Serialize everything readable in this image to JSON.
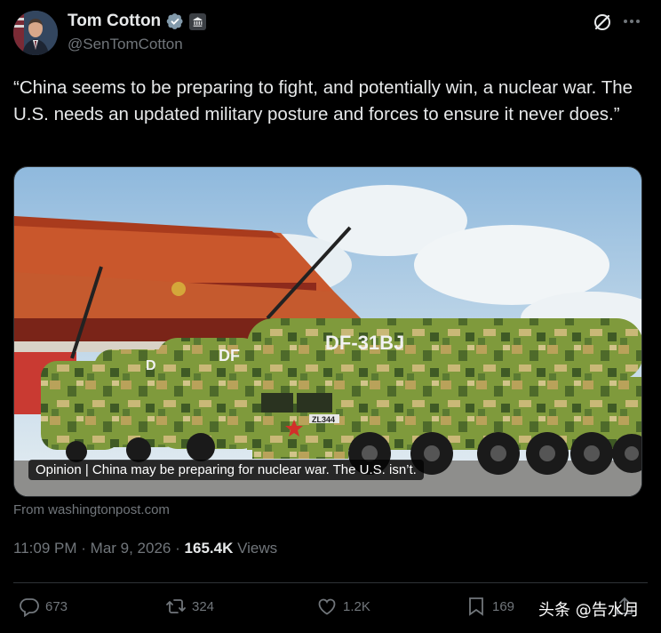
{
  "author": {
    "display_name": "Tom Cotton",
    "handle": "@SenTomCotton"
  },
  "tweet": {
    "text": "“China seems to be preparing to fight, and potentially win, a nuclear war. The U.S. needs an updated military posture and forces to ensure it never does.”"
  },
  "card": {
    "title": "Opinion | China may be preparing for nuclear war. The U.S. isn’t.",
    "source": "From washingtonpost.com",
    "image_texts": {
      "missile_marking": "DF-31BJ",
      "plate": "ZL344",
      "second_missile_marking": "DF",
      "third_missile_marking": "D"
    }
  },
  "meta": {
    "time": "11:09 PM",
    "separator": "·",
    "date": "Mar 9, 2026",
    "views_count": "165.4K",
    "views_label": "Views"
  },
  "actions": {
    "replies": "673",
    "reposts": "324",
    "likes": "1.2K",
    "bookmarks": "169"
  },
  "watermark": "头条 @告水月",
  "colors": {
    "background": "#000000",
    "primary_text": "#e7e9ea",
    "secondary_text": "#71767b",
    "verified_blue": "#829aab",
    "divider": "#2f3336"
  },
  "icons": [
    "verified-badge-icon",
    "government-badge-icon",
    "grok-icon",
    "more-icon",
    "reply-icon",
    "retweet-icon",
    "like-icon",
    "bookmark-icon",
    "share-icon"
  ]
}
